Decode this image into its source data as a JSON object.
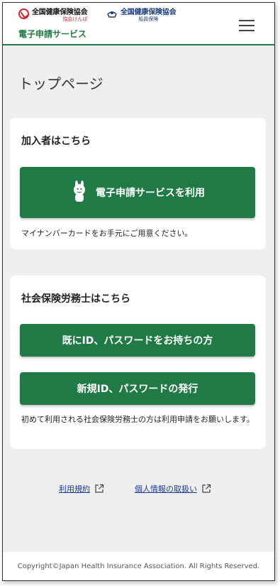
{
  "header": {
    "logo1": {
      "name": "全国健康保険協会",
      "sub": "協会けんぽ"
    },
    "logo2": {
      "name": "全国健康保険協会",
      "sub": "船員保険"
    },
    "service_title": "電子申請サービス"
  },
  "page_title": "トップページ",
  "card_members": {
    "heading": "加入者はこちら",
    "button_label": "電子申請サービスを利用",
    "note": "マイナンバーカードをお手元にご用意ください。"
  },
  "card_sharoushi": {
    "heading": "社会保険労務士はこちら",
    "button_existing": "既にID、パスワードをお持ちの方",
    "button_new": "新規ID、パスワードの発行",
    "note": "初めて利用される社会保険労務士の方は利用申請をお願いします。"
  },
  "footer_links": {
    "terms": "利用規約",
    "privacy": "個人情報の取扱い"
  },
  "copyright": "Copyright©Japan Health Insurance Association. All Rights Reserved.",
  "colors": {
    "accent": "#1f7a45",
    "link": "#1a3b9a",
    "background": "#efefef"
  },
  "icons": {
    "menu": "hamburger-icon",
    "external": "external-link-icon",
    "mascot": "mascot-icon"
  }
}
